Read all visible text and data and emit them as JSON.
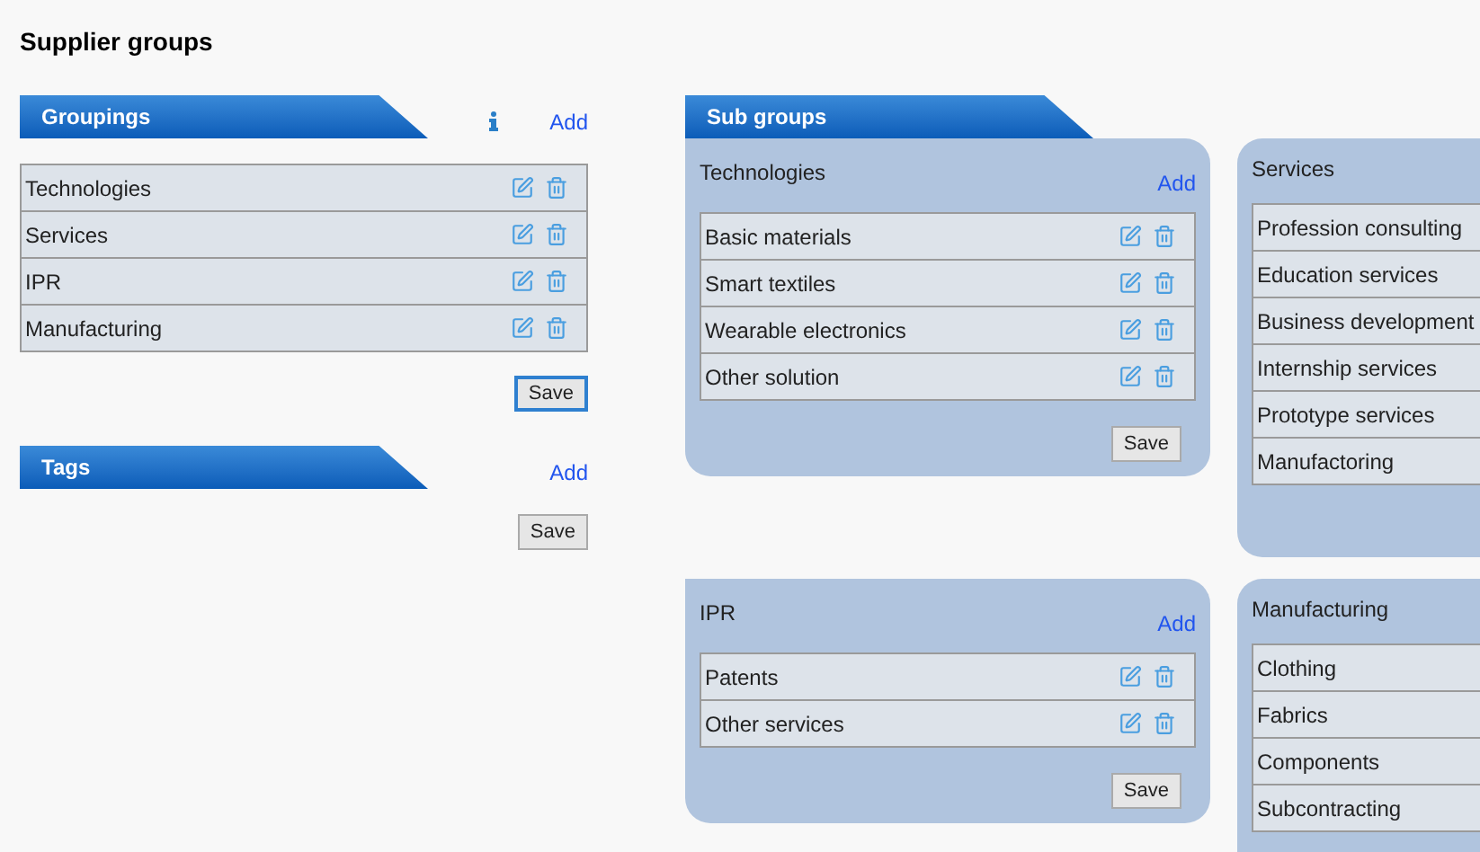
{
  "title": "Supplier groups",
  "groupings": {
    "header": "Groupings",
    "add": "Add",
    "items": [
      "Technologies",
      "Services",
      "IPR",
      "Manufacturing"
    ],
    "save": "Save",
    "save_focused": true
  },
  "tags": {
    "header": "Tags",
    "add": "Add",
    "save": "Save",
    "save_focused": false
  },
  "subgroups": {
    "header": "Sub groups",
    "cards": [
      {
        "kind": "full",
        "title": "Technologies",
        "add": "Add",
        "items": [
          "Basic materials",
          "Smart textiles",
          "Wearable electronics",
          "Other solution"
        ],
        "save": "Save"
      },
      {
        "kind": "cut",
        "title": "Services",
        "items": [
          "Profession consulting",
          "Education services",
          "Business development",
          "Internship services",
          "Prototype services",
          "Manufactoring"
        ]
      },
      {
        "kind": "full",
        "title": "IPR",
        "add": "Add",
        "items": [
          "Patents",
          "Other services"
        ],
        "save": "Save"
      },
      {
        "kind": "cut",
        "title": "Manufacturing",
        "items": [
          "Clothing",
          "Fabrics",
          "Components",
          "Subcontracting"
        ]
      }
    ]
  }
}
